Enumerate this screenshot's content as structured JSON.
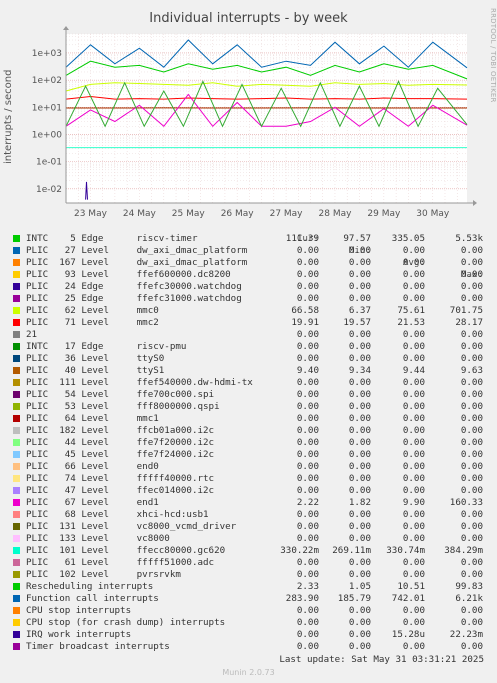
{
  "title": "Individual interrupts - by week",
  "side_text": "RRDTOOL / TOBI OETIKER",
  "legend_header": {
    "cur": "Cur:",
    "min": "Min:",
    "avg": "Avg:",
    "max": "Max:"
  },
  "last_update": "Last update: Sat May 31 03:31:21 2025",
  "generator": "Munin 2.0.73",
  "chart_data": {
    "type": "line",
    "title": "Individual interrupts - by week",
    "ylabel": "interrupts / second",
    "yscale": "log",
    "ylim": [
      0.003,
      5000
    ],
    "yticks": [
      {
        "value": 1000,
        "label": "1e+03"
      },
      {
        "value": 100,
        "label": "1e+02"
      },
      {
        "value": 10,
        "label": "1e+01"
      },
      {
        "value": 1,
        "label": "1e+00"
      },
      {
        "value": 0.1,
        "label": "1e-01"
      },
      {
        "value": 0.01,
        "label": "1e-02"
      }
    ],
    "xlim": [
      0,
      8.2
    ],
    "xticks": [
      {
        "value": 0.5,
        "label": "23 May"
      },
      {
        "value": 1.5,
        "label": "24 May"
      },
      {
        "value": 2.5,
        "label": "25 May"
      },
      {
        "value": 3.5,
        "label": "26 May"
      },
      {
        "value": 4.5,
        "label": "27 May"
      },
      {
        "value": 5.5,
        "label": "28 May"
      },
      {
        "value": 6.5,
        "label": "29 May"
      },
      {
        "value": 7.5,
        "label": "30 May"
      }
    ],
    "grid": true,
    "series": [
      {
        "name": "PLIC   62 Level     mmc0",
        "color": "#ccff00",
        "points": [
          [
            0,
            40
          ],
          [
            0.5,
            70
          ],
          [
            1,
            80
          ],
          [
            1.5,
            75
          ],
          [
            2,
            70
          ],
          [
            2.5,
            65
          ],
          [
            3,
            80
          ],
          [
            3.5,
            60
          ],
          [
            4,
            70
          ],
          [
            4.5,
            65
          ],
          [
            5,
            60
          ],
          [
            5.5,
            80
          ],
          [
            6,
            70
          ],
          [
            6.5,
            75
          ],
          [
            7,
            65
          ],
          [
            7.5,
            70
          ],
          [
            8.2,
            66
          ]
        ]
      },
      {
        "name": "PLIC   71 Level     mmc2",
        "color": "#ff0000",
        "points": [
          [
            0,
            20
          ],
          [
            0.5,
            25
          ],
          [
            1,
            20
          ],
          [
            1.5,
            21
          ],
          [
            2,
            20
          ],
          [
            2.5,
            22
          ],
          [
            3,
            21
          ],
          [
            3.5,
            20
          ],
          [
            4,
            21
          ],
          [
            4.5,
            22
          ],
          [
            5,
            20
          ],
          [
            5.5,
            21
          ],
          [
            6,
            20
          ],
          [
            6.5,
            22
          ],
          [
            7,
            21
          ],
          [
            7.5,
            21
          ],
          [
            8.2,
            20
          ]
        ]
      },
      {
        "name": "PLIC   40 Level     ttyS1",
        "color": "#aa3300",
        "points": [
          [
            0,
            9.4
          ],
          [
            1,
            9.4
          ],
          [
            2,
            9.5
          ],
          [
            3,
            9.4
          ],
          [
            4,
            9.4
          ],
          [
            5,
            9.5
          ],
          [
            6,
            9.4
          ],
          [
            7,
            9.4
          ],
          [
            8.2,
            9.4
          ]
        ]
      },
      {
        "name": "PLIC  101 Level     ffecc80000.gc620",
        "color": "#33ffcc",
        "points": [
          [
            0,
            0.33
          ],
          [
            8.2,
            0.33
          ]
        ]
      },
      {
        "name": "PLIC   67 Level     end1",
        "color": "#ee00cc",
        "points": [
          [
            0,
            2
          ],
          [
            0.5,
            8
          ],
          [
            1,
            3
          ],
          [
            1.5,
            12
          ],
          [
            2,
            2
          ],
          [
            2.5,
            30
          ],
          [
            3,
            2
          ],
          [
            3.5,
            15
          ],
          [
            4,
            2
          ],
          [
            4.5,
            2
          ],
          [
            5,
            3
          ],
          [
            5.5,
            10
          ],
          [
            6,
            2
          ],
          [
            6.5,
            9
          ],
          [
            7,
            2
          ],
          [
            7.5,
            12
          ],
          [
            8.2,
            2.2
          ]
        ]
      },
      {
        "name": "Rescheduling interrupts",
        "color": "#33aa33",
        "points": [
          [
            0,
            2
          ],
          [
            0.4,
            60
          ],
          [
            0.8,
            2
          ],
          [
            1.2,
            80
          ],
          [
            1.6,
            2
          ],
          [
            2,
            40
          ],
          [
            2.4,
            2
          ],
          [
            2.8,
            90
          ],
          [
            3.2,
            2
          ],
          [
            3.6,
            70
          ],
          [
            4,
            2
          ],
          [
            4.4,
            50
          ],
          [
            4.8,
            2
          ],
          [
            5.2,
            80
          ],
          [
            5.6,
            2
          ],
          [
            6,
            60
          ],
          [
            6.4,
            2
          ],
          [
            6.8,
            90
          ],
          [
            7.2,
            2
          ],
          [
            7.6,
            50
          ],
          [
            8.2,
            2.3
          ]
        ]
      },
      {
        "name": "INTC    5 Edge      riscv-timer",
        "color": "#00cc00",
        "points": [
          [
            0,
            150
          ],
          [
            0.5,
            500
          ],
          [
            1,
            300
          ],
          [
            1.5,
            350
          ],
          [
            2,
            200
          ],
          [
            2.5,
            400
          ],
          [
            3,
            250
          ],
          [
            3.5,
            350
          ],
          [
            4,
            200
          ],
          [
            4.5,
            300
          ],
          [
            5,
            150
          ],
          [
            5.5,
            350
          ],
          [
            6,
            200
          ],
          [
            6.5,
            400
          ],
          [
            7,
            250
          ],
          [
            7.5,
            350
          ],
          [
            8.2,
            111
          ]
        ]
      },
      {
        "name": "Function call interrupts",
        "color": "#0066b3",
        "points": [
          [
            0,
            300
          ],
          [
            0.5,
            2000
          ],
          [
            1,
            400
          ],
          [
            1.5,
            1500
          ],
          [
            2,
            300
          ],
          [
            2.5,
            3000
          ],
          [
            3,
            400
          ],
          [
            3.5,
            2000
          ],
          [
            4,
            300
          ],
          [
            4.5,
            500
          ],
          [
            5,
            350
          ],
          [
            5.5,
            2500
          ],
          [
            6,
            400
          ],
          [
            6.5,
            1800
          ],
          [
            7,
            300
          ],
          [
            7.5,
            2500
          ],
          [
            8.2,
            284
          ]
        ]
      },
      {
        "name": "IRQ work interrupts",
        "color": "#330099",
        "points": [
          [
            0.4,
            0.004
          ],
          [
            0.42,
            0.018
          ],
          [
            0.44,
            0.004
          ]
        ]
      }
    ]
  },
  "legend": [
    {
      "color": "#00cc00",
      "name": "INTC    5 Edge      riscv-timer",
      "cur": "111.39",
      "min": "97.57",
      "avg": "335.05",
      "max": "5.53k"
    },
    {
      "color": "#0066b3",
      "name": "PLIC   27 Level     dw_axi_dmac_platform",
      "cur": "0.00",
      "min": "0.00",
      "avg": "0.00",
      "max": "0.00"
    },
    {
      "color": "#ff8000",
      "name": "PLIC  167 Level     dw_axi_dmac_platform",
      "cur": "0.00",
      "min": "0.00",
      "avg": "0.00",
      "max": "0.00"
    },
    {
      "color": "#ffcc00",
      "name": "PLIC   93 Level     ffef600000.dc8200",
      "cur": "0.00",
      "min": "0.00",
      "avg": "0.00",
      "max": "0.00"
    },
    {
      "color": "#330099",
      "name": "PLIC   24 Edge      ffefc30000.watchdog",
      "cur": "0.00",
      "min": "0.00",
      "avg": "0.00",
      "max": "0.00"
    },
    {
      "color": "#990099",
      "name": "PLIC   25 Edge      ffefc31000.watchdog",
      "cur": "0.00",
      "min": "0.00",
      "avg": "0.00",
      "max": "0.00"
    },
    {
      "color": "#ccff00",
      "name": "PLIC   62 Level     mmc0",
      "cur": "66.58",
      "min": "6.37",
      "avg": "75.61",
      "max": "701.75"
    },
    {
      "color": "#ff0000",
      "name": "PLIC   71 Level     mmc2",
      "cur": "19.91",
      "min": "19.57",
      "avg": "21.53",
      "max": "28.17"
    },
    {
      "color": "#808080",
      "name": "21",
      "cur": "0.00",
      "min": "0.00",
      "avg": "0.00",
      "max": "0.00"
    },
    {
      "color": "#008f00",
      "name": "INTC   17 Edge      riscv-pmu",
      "cur": "0.00",
      "min": "0.00",
      "avg": "0.00",
      "max": "0.00"
    },
    {
      "color": "#00487d",
      "name": "PLIC   36 Level     ttyS0",
      "cur": "0.00",
      "min": "0.00",
      "avg": "0.00",
      "max": "0.00"
    },
    {
      "color": "#b35a00",
      "name": "PLIC   40 Level     ttyS1",
      "cur": "9.40",
      "min": "9.34",
      "avg": "9.44",
      "max": "9.63"
    },
    {
      "color": "#b38f00",
      "name": "PLIC  111 Level     ffef540000.dw-hdmi-tx",
      "cur": "0.00",
      "min": "0.00",
      "avg": "0.00",
      "max": "0.00"
    },
    {
      "color": "#6b006b",
      "name": "PLIC   54 Level     ffe700c000.spi",
      "cur": "0.00",
      "min": "0.00",
      "avg": "0.00",
      "max": "0.00"
    },
    {
      "color": "#8fb300",
      "name": "PLIC   53 Level     fff8000000.qspi",
      "cur": "0.00",
      "min": "0.00",
      "avg": "0.00",
      "max": "0.00"
    },
    {
      "color": "#b30000",
      "name": "PLIC   64 Level     mmc1",
      "cur": "0.00",
      "min": "0.00",
      "avg": "0.00",
      "max": "0.00"
    },
    {
      "color": "#bebebe",
      "name": "PLIC  182 Level     ffcb01a000.i2c",
      "cur": "0.00",
      "min": "0.00",
      "avg": "0.00",
      "max": "0.00"
    },
    {
      "color": "#80ff80",
      "name": "PLIC   44 Level     ffe7f20000.i2c",
      "cur": "0.00",
      "min": "0.00",
      "avg": "0.00",
      "max": "0.00"
    },
    {
      "color": "#80c9ff",
      "name": "PLIC   45 Level     ffe7f24000.i2c",
      "cur": "0.00",
      "min": "0.00",
      "avg": "0.00",
      "max": "0.00"
    },
    {
      "color": "#ffc080",
      "name": "PLIC   66 Level     end0",
      "cur": "0.00",
      "min": "0.00",
      "avg": "0.00",
      "max": "0.00"
    },
    {
      "color": "#ffe680",
      "name": "PLIC   74 Level     fffff40000.rtc",
      "cur": "0.00",
      "min": "0.00",
      "avg": "0.00",
      "max": "0.00"
    },
    {
      "color": "#aa80ff",
      "name": "PLIC   47 Level     ffec014000.i2c",
      "cur": "0.00",
      "min": "0.00",
      "avg": "0.00",
      "max": "0.00"
    },
    {
      "color": "#ee00cc",
      "name": "PLIC   67 Level     end1",
      "cur": "2.22",
      "min": "1.82",
      "avg": "9.90",
      "max": "160.33"
    },
    {
      "color": "#ff8080",
      "name": "PLIC   68 Level     xhci-hcd:usb1",
      "cur": "0.00",
      "min": "0.00",
      "avg": "0.00",
      "max": "0.00"
    },
    {
      "color": "#666600",
      "name": "PLIC  131 Level     vc8000_vcmd_driver",
      "cur": "0.00",
      "min": "0.00",
      "avg": "0.00",
      "max": "0.00"
    },
    {
      "color": "#ffbfff",
      "name": "PLIC  133 Level     vc8000",
      "cur": "0.00",
      "min": "0.00",
      "avg": "0.00",
      "max": "0.00"
    },
    {
      "color": "#00ffcc",
      "name": "PLIC  101 Level     ffecc80000.gc620",
      "cur": "330.22m",
      "min": "269.11m",
      "avg": "330.74m",
      "max": "384.29m"
    },
    {
      "color": "#cc6699",
      "name": "PLIC   61 Level     fffff51000.adc",
      "cur": "0.00",
      "min": "0.00",
      "avg": "0.00",
      "max": "0.00"
    },
    {
      "color": "#999900",
      "name": "PLIC  102 Level     pvrsrvkm",
      "cur": "0.00",
      "min": "0.00",
      "avg": "0.00",
      "max": "0.00"
    },
    {
      "color": "#00cc00",
      "name": "Rescheduling interrupts",
      "cur": "2.33",
      "min": "1.05",
      "avg": "10.51",
      "max": "99.83"
    },
    {
      "color": "#0066b3",
      "name": "Function call interrupts",
      "cur": "283.90",
      "min": "185.79",
      "avg": "742.01",
      "max": "6.21k"
    },
    {
      "color": "#ff8000",
      "name": "CPU stop interrupts",
      "cur": "0.00",
      "min": "0.00",
      "avg": "0.00",
      "max": "0.00"
    },
    {
      "color": "#ffcc00",
      "name": "CPU stop (for crash dump) interrupts",
      "cur": "0.00",
      "min": "0.00",
      "avg": "0.00",
      "max": "0.00"
    },
    {
      "color": "#330099",
      "name": "IRQ work interrupts",
      "cur": "0.00",
      "min": "0.00",
      "avg": "15.28u",
      "max": "22.23m"
    },
    {
      "color": "#990099",
      "name": "Timer broadcast interrupts",
      "cur": "0.00",
      "min": "0.00",
      "avg": "0.00",
      "max": "0.00"
    }
  ]
}
